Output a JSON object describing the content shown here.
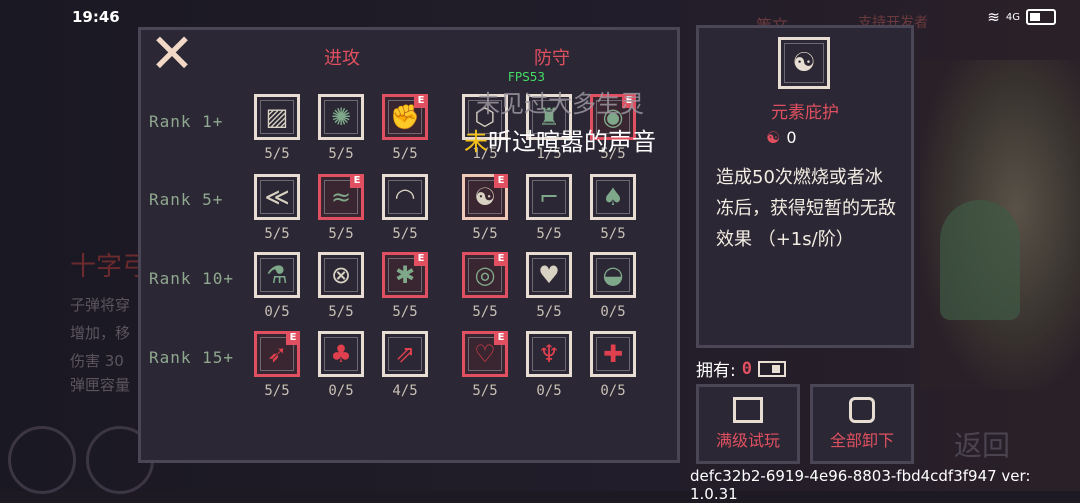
{
  "status": {
    "time": "19:46",
    "network": "4G"
  },
  "background": {
    "left_title": "十字弓",
    "left_lines": [
      "子弹将穿",
      "增加，移",
      "伤害 30",
      "弹匣容量"
    ],
    "top_tab": "策文",
    "top_right": "支持开发者",
    "back": "返回"
  },
  "panel": {
    "close": "✕",
    "col_attack": "进攻",
    "col_defense": "防守",
    "ranks": [
      "Rank 1+",
      "Rank 5+",
      "Rank 10+",
      "Rank 15+"
    ]
  },
  "skills": [
    {
      "row": 0,
      "col": 0,
      "glyph": "▨",
      "count": "5/5",
      "equipped": false,
      "color": "white"
    },
    {
      "row": 0,
      "col": 1,
      "glyph": "✺",
      "count": "5/5",
      "equipped": false,
      "color": "green"
    },
    {
      "row": 0,
      "col": 2,
      "glyph": "✊",
      "count": "5/5",
      "equipped": true,
      "color": "green"
    },
    {
      "row": 0,
      "col": 3,
      "glyph": "⬡",
      "count": "1/5",
      "equipped": false,
      "color": "white"
    },
    {
      "row": 0,
      "col": 4,
      "glyph": "♜",
      "count": "1/5",
      "equipped": false,
      "color": "green"
    },
    {
      "row": 0,
      "col": 5,
      "glyph": "◉",
      "count": "5/5",
      "equipped": true,
      "color": "green"
    },
    {
      "row": 1,
      "col": 0,
      "glyph": "≪",
      "count": "5/5",
      "equipped": false,
      "color": "white"
    },
    {
      "row": 1,
      "col": 1,
      "glyph": "≈",
      "count": "5/5",
      "equipped": true,
      "color": "green"
    },
    {
      "row": 1,
      "col": 2,
      "glyph": "◠",
      "count": "5/5",
      "equipped": false,
      "color": "white"
    },
    {
      "row": 1,
      "col": 3,
      "glyph": "☯",
      "count": "5/5",
      "equipped": true,
      "color": "white",
      "selected": true
    },
    {
      "row": 1,
      "col": 4,
      "glyph": "⌐",
      "count": "5/5",
      "equipped": false,
      "color": "green"
    },
    {
      "row": 1,
      "col": 5,
      "glyph": "♠",
      "count": "5/5",
      "equipped": false,
      "color": "green"
    },
    {
      "row": 2,
      "col": 0,
      "glyph": "⚗",
      "count": "0/5",
      "equipped": false,
      "color": "green"
    },
    {
      "row": 2,
      "col": 1,
      "glyph": "⊗",
      "count": "5/5",
      "equipped": false,
      "color": "white"
    },
    {
      "row": 2,
      "col": 2,
      "glyph": "✱",
      "count": "5/5",
      "equipped": true,
      "color": "green"
    },
    {
      "row": 2,
      "col": 3,
      "glyph": "◎",
      "count": "5/5",
      "equipped": true,
      "color": "green"
    },
    {
      "row": 2,
      "col": 4,
      "glyph": "♥",
      "count": "5/5",
      "equipped": false,
      "color": "white"
    },
    {
      "row": 2,
      "col": 5,
      "glyph": "◒",
      "count": "0/5",
      "equipped": false,
      "color": "green"
    },
    {
      "row": 3,
      "col": 0,
      "glyph": "➶",
      "count": "5/5",
      "equipped": true,
      "color": "red"
    },
    {
      "row": 3,
      "col": 1,
      "glyph": "♣",
      "count": "0/5",
      "equipped": false,
      "color": "red"
    },
    {
      "row": 3,
      "col": 2,
      "glyph": "⇗",
      "count": "4/5",
      "equipped": false,
      "color": "red"
    },
    {
      "row": 3,
      "col": 3,
      "glyph": "♡",
      "count": "5/5",
      "equipped": true,
      "color": "red"
    },
    {
      "row": 3,
      "col": 4,
      "glyph": "♆",
      "count": "0/5",
      "equipped": false,
      "color": "red"
    },
    {
      "row": 3,
      "col": 5,
      "glyph": "✚",
      "count": "0/5",
      "equipped": false,
      "color": "red"
    }
  ],
  "e_label": "E",
  "overlay": {
    "fps": "FPS53",
    "line1": "未见过大多生灵",
    "line2_hl": "未",
    "line2_rest": "听过喧嚣的声音"
  },
  "detail": {
    "icon": "☯",
    "title": "元素庇护",
    "cost": "0",
    "desc": "造成50次燃烧或者冰冻后，获得短暂的无敌效果 （+1s/阶）"
  },
  "own": {
    "label": "拥有:",
    "value": "0"
  },
  "buttons": {
    "trial": "满级试玩",
    "unequip_all": "全部卸下"
  },
  "footer": "defc32b2-6919-4e96-8803-fbd4cdf3f947 ver: 1.0.31"
}
